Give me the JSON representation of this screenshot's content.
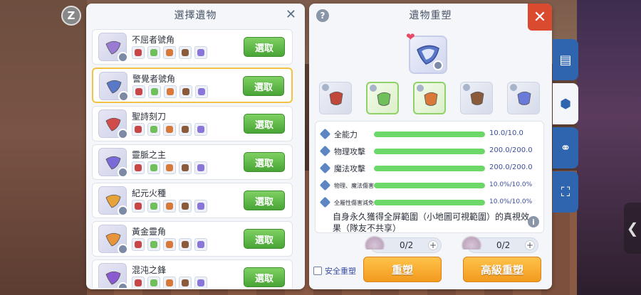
{
  "top_left_button": {
    "glyph": "Z"
  },
  "select_panel": {
    "title": "選擇遺物",
    "close_glyph": "✕",
    "select_label": "選取",
    "items": [
      {
        "name": "不屈者號角",
        "selected": false,
        "color": "#9a7bd4"
      },
      {
        "name": "警覺者號角",
        "selected": true,
        "color": "#5a78c8"
      },
      {
        "name": "聖詩刻刀",
        "selected": false,
        "color": "#d24b4b"
      },
      {
        "name": "靈脈之主",
        "selected": false,
        "color": "#7a6ad8"
      },
      {
        "name": "紀元火種",
        "selected": false,
        "color": "#e8a23a"
      },
      {
        "name": "黃金靈角",
        "selected": false,
        "color": "#e8943a"
      },
      {
        "name": "混沌之鋒",
        "selected": false,
        "color": "#8a5ad0"
      }
    ]
  },
  "reshape_panel": {
    "title": "遺物重塑",
    "help_glyph": "?",
    "close_glyph": "✕",
    "heart_glyph": "❤",
    "materials": [
      {
        "icon": "helmet-icon",
        "color": "#c0483a",
        "highlighted": false
      },
      {
        "icon": "crystal-icon",
        "color": "#6fbf5a",
        "highlighted": true
      },
      {
        "icon": "feather-icon",
        "color": "#d8793a",
        "highlighted": true
      },
      {
        "icon": "gun-icon",
        "color": "#8a5a3a",
        "highlighted": false
      },
      {
        "icon": "gem-icon",
        "color": "#6a7ad8",
        "highlighted": false
      }
    ],
    "stats": [
      {
        "label": "全能力",
        "value": "10.0/10.0",
        "fill": 1.0,
        "small": false
      },
      {
        "label": "物理攻擊",
        "value": "200.0/200.0",
        "fill": 1.0,
        "small": false
      },
      {
        "label": "魔法攻擊",
        "value": "200.0/200.0",
        "fill": 1.0,
        "small": false
      },
      {
        "label": "物理、魔法傷害",
        "value": "10.0%/10.0%",
        "fill": 1.0,
        "small": true
      },
      {
        "label": "全屬性傷害減免",
        "value": "10.0%/10.0%",
        "fill": 1.0,
        "small": true
      }
    ],
    "description": "自身永久獲得全屏範圍（小地圖可視範圍）的真視效果（隊友不共享）",
    "info_glyph": "i",
    "counters": [
      {
        "count": "0/2",
        "plus": "+"
      },
      {
        "count": "0/2",
        "plus": "+"
      }
    ],
    "safe_label": "安全重塑",
    "reshape_label": "重塑",
    "advanced_reshape_label": "高級重塑"
  },
  "side_tabs": [
    {
      "icon": "shop-icon",
      "glyph": "▤",
      "active": false
    },
    {
      "icon": "relic-icon",
      "glyph": "⬢",
      "active": true
    },
    {
      "icon": "nodes-icon",
      "glyph": "⚭",
      "active": false
    },
    {
      "icon": "scan-icon",
      "glyph": "⛶",
      "active": false
    }
  ],
  "edge_arrow_glyph": "❮"
}
